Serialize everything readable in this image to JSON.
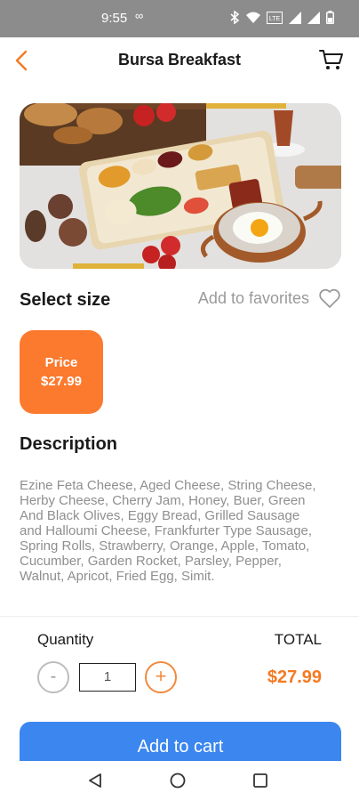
{
  "status_bar": {
    "time": "9:55",
    "extra": "∞",
    "icons": [
      "bluetooth-icon",
      "wifi-icon",
      "lte-icon",
      "signal-icon",
      "signal-icon",
      "battery-icon"
    ],
    "lte_text": "LTE"
  },
  "header": {
    "title": "Bursa Breakfast",
    "back_icon": "chevron-left-icon",
    "cart_icon": "cart-icon"
  },
  "hero": {
    "image": "breakfast-spread-photo"
  },
  "size": {
    "label": "Select size",
    "favorites_label": "Add to favorites",
    "favorites_icon": "heart-icon",
    "options": [
      {
        "label": "Price",
        "value": "$27.99"
      }
    ]
  },
  "description": {
    "title": "Description",
    "text": "Ezine Feta Cheese, Aged Cheese, String Cheese, Herby Cheese, Cherry Jam, Honey, Buer, Green And Black Olives, Eggy Bread, Grilled Sausage and Halloumi Cheese, Frankfurter Type Sausage, Spring Rolls, Strawberry, Orange, Apple, Tomato, Cucumber, Garden Rocket, Parsley, Pepper, Walnut, Apricot, Fried Egg, Simit."
  },
  "order": {
    "quantity_label": "Quantity",
    "total_label": "TOTAL",
    "minus": "-",
    "plus": "+",
    "quantity_value": "1",
    "total_value": "$27.99"
  },
  "cta": {
    "label": "Add to cart"
  },
  "colors": {
    "accent_orange": "#fb7a2e",
    "button_blue": "#3b86ef",
    "status_bar": "#8c8c8c"
  },
  "system_nav": [
    "nav-back-icon",
    "nav-home-icon",
    "nav-recents-icon"
  ]
}
